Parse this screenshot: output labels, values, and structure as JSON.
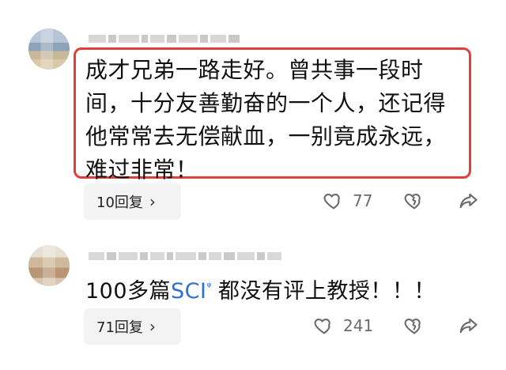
{
  "comments": [
    {
      "text": "成才兄弟一路走好。曾共事一段时间，十分友善勤奋的一个人，还记得他常常去无偿献血，一别竟成永远，难过非常！",
      "reply_label": "10回复",
      "likes": "77"
    },
    {
      "text_prefix": "100多篇",
      "text_link": "SCI",
      "text_suffix": "都没有评上教授！！！",
      "reply_label": "71回复",
      "likes": "241"
    }
  ],
  "icons": {
    "like": "heart-icon",
    "dislike": "broken-heart-icon",
    "share": "share-arrow-icon",
    "reply_chevron": "chevron-right-icon",
    "search_hint": "search-icon"
  },
  "colors": {
    "highlight_border": "#e0403a",
    "link": "#2f6fd1",
    "reply_bg": "#f3f3f3",
    "icon_gray": "#6b6b6b"
  }
}
